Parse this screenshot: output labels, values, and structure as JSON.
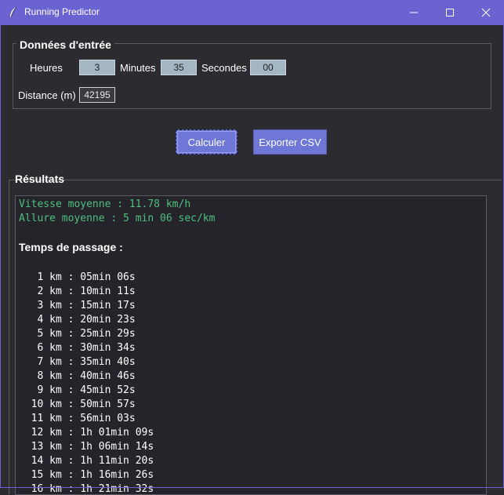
{
  "window": {
    "title": "Running Predictor",
    "title_bar_color": "#6b63d2"
  },
  "inputs": {
    "group_title": "Données d'entrée",
    "hours_label": "Heures",
    "hours_value": "3",
    "minutes_label": "Minutes",
    "minutes_value": "35",
    "seconds_label": "Secondes",
    "seconds_value": "00",
    "distance_label": "Distance (m)",
    "distance_value": "42195"
  },
  "buttons": {
    "calculate": "Calculer",
    "export_csv": "Exporter CSV",
    "button_color": "#6e76d6"
  },
  "results": {
    "title": "Résultats",
    "speed_line": "Vitesse moyenne : 11.78 km/h",
    "pace_line": "Allure moyenne : 5 min 06 sec/km",
    "passage_title": "Temps de passage :",
    "accent_color": "#4fbf7f",
    "splits": [
      "   1 km : 05min 06s",
      "   2 km : 10min 11s",
      "   3 km : 15min 17s",
      "   4 km : 20min 23s",
      "   5 km : 25min 29s",
      "   6 km : 30min 34s",
      "   7 km : 35min 40s",
      "   8 km : 40min 46s",
      "   9 km : 45min 52s",
      "  10 km : 50min 57s",
      "  11 km : 56min 03s",
      "  12 km : 1h 01min 09s",
      "  13 km : 1h 06min 14s",
      "  14 km : 1h 11min 20s",
      "  15 km : 1h 16min 26s",
      "  16 km : 1h 21min 32s"
    ]
  }
}
